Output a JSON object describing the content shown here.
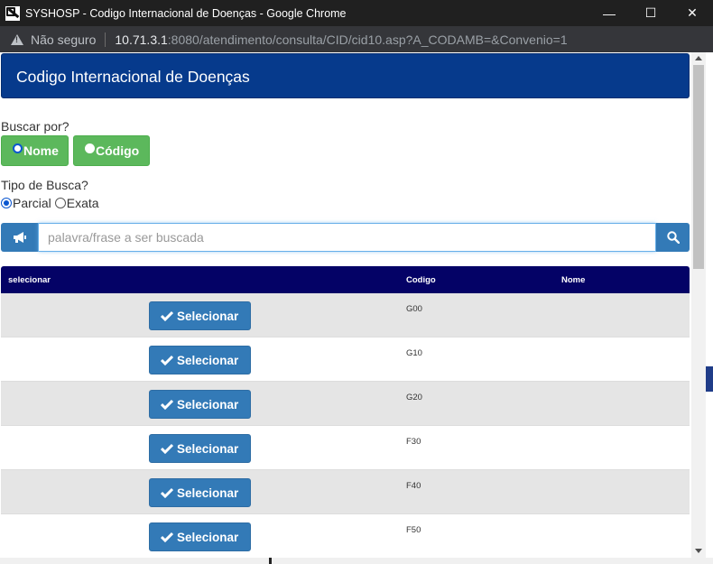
{
  "window": {
    "title": "SYSHOSP - Codigo Internacional de Doenças - Google Chrome",
    "minimize": "—",
    "maximize": "☐",
    "close": "✕"
  },
  "address": {
    "security_label": "Não seguro",
    "host": "10.71.3.1",
    "path": ":8080/atendimento/consulta/CID/cid10.asp?A_CODAMB=&Convenio=1"
  },
  "page": {
    "header_title": "Codigo Internacional de Doenças",
    "search_by_label": "Buscar por?",
    "search_by_options": [
      "Nome",
      "Código"
    ],
    "search_by_selected": "Nome",
    "search_type_label": "Tipo de Busca?",
    "search_type_options": [
      "Parcial",
      "Exata"
    ],
    "search_type_selected": "Parcial",
    "search_placeholder": "palavra/frase a ser buscada",
    "search_value": ""
  },
  "table": {
    "headers": [
      "selecionar",
      "Codigo",
      "Nome"
    ],
    "select_label": "Selecionar",
    "rows": [
      {
        "code": "G00",
        "name": ""
      },
      {
        "code": "G10",
        "name": ""
      },
      {
        "code": "G20",
        "name": ""
      },
      {
        "code": "F30",
        "name": ""
      },
      {
        "code": "F40",
        "name": ""
      },
      {
        "code": "F50",
        "name": ""
      }
    ]
  },
  "colors": {
    "header_bg": "#063a8c",
    "table_header_bg": "#040266",
    "green_button": "#5cb85c",
    "blue_button": "#337ab7"
  },
  "icons": {
    "search_addon": "megaphone-icon",
    "search_button": "search-icon",
    "select_button": "check-icon",
    "address_warning": "warning-icon"
  }
}
